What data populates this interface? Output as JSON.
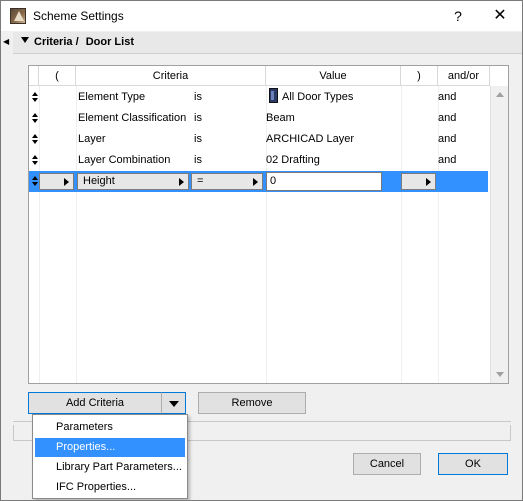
{
  "window": {
    "title": "Scheme Settings",
    "help_label": "?",
    "close_label": "✕"
  },
  "header": {
    "section": "Criteria /",
    "subsection": "Door List"
  },
  "table": {
    "columns": {
      "open_paren": "(",
      "criteria": "Criteria",
      "value": "Value",
      "close_paren": ")",
      "andor": "and/or"
    },
    "rows": [
      {
        "criteria": "Element Type",
        "operator": "is",
        "value": "All Door Types",
        "andor": "and",
        "has_icon": true
      },
      {
        "criteria": "Element Classification",
        "operator": "is",
        "value": "Beam",
        "andor": "and"
      },
      {
        "criteria": "Layer",
        "operator": "is",
        "value": "ARCHICAD Layer",
        "andor": "and"
      },
      {
        "criteria": "Layer Combination",
        "operator": "is",
        "value": "02 Drafting",
        "andor": "and"
      }
    ],
    "selected_row": {
      "criteria": "Height",
      "operator": "=",
      "value": "0"
    }
  },
  "buttons": {
    "add_criteria": "Add Criteria",
    "remove": "Remove",
    "cancel": "Cancel",
    "ok": "OK"
  },
  "add_menu": {
    "items": [
      "Parameters",
      "Properties...",
      "Library Part Parameters...",
      "IFC Properties..."
    ],
    "highlighted": "Properties..."
  },
  "colors": {
    "selection": "#3390ff",
    "focus_border": "#0078d7"
  }
}
